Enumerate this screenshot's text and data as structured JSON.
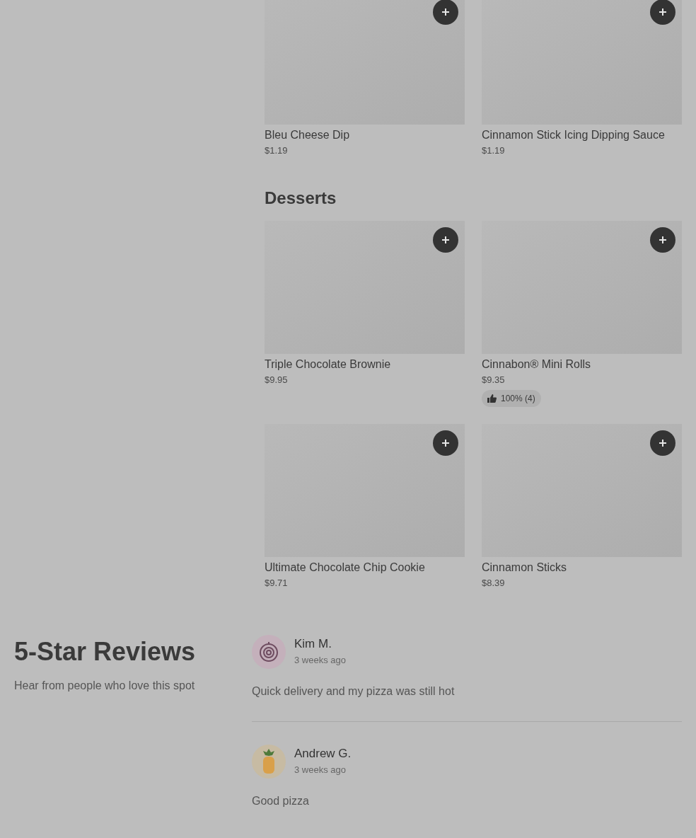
{
  "top_items": [
    {
      "name": "Bleu Cheese Dip",
      "price": "$1.19"
    },
    {
      "name": "Cinnamon Stick Icing Dipping Sauce",
      "price": "$1.19"
    }
  ],
  "sections": [
    {
      "title": "Desserts",
      "items": [
        {
          "name": "Triple Chocolate Brownie",
          "price": "$9.95"
        },
        {
          "name": "Cinnabon® Mini Rolls",
          "price": "$9.35",
          "rating": "100% (4)"
        },
        {
          "name": "Ultimate Chocolate Chip Cookie",
          "price": "$9.71"
        },
        {
          "name": "Cinnamon Sticks",
          "price": "$8.39"
        }
      ]
    }
  ],
  "reviews": {
    "title": "5-Star Reviews",
    "subtitle": "Hear from people who love this spot",
    "items": [
      {
        "author": "Kim M.",
        "time": "3 weeks ago",
        "text": "Quick delivery and my pizza was still hot",
        "kind": "target"
      },
      {
        "author": "Andrew G.",
        "time": "3 weeks ago",
        "text": "Good pizza",
        "kind": "pineapple"
      }
    ]
  }
}
